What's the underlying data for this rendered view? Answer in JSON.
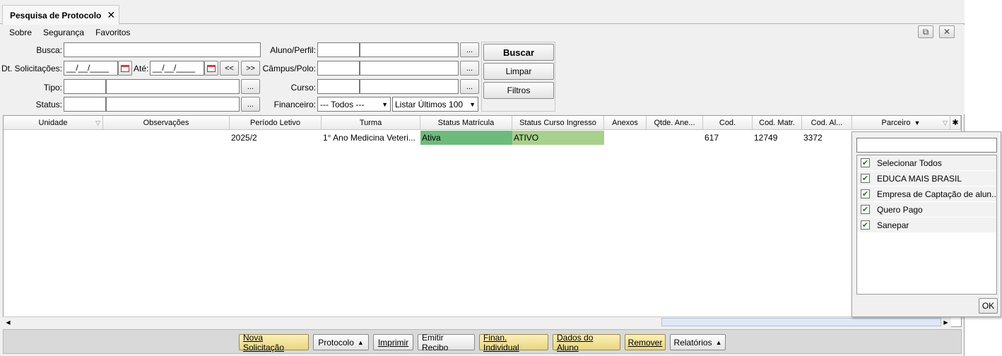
{
  "tab": {
    "title": "Pesquisa de Protocolo",
    "close": "✕"
  },
  "menu": [
    "Sobre",
    "Segurança",
    "Favoritos"
  ],
  "window_buttons": {
    "popout": "⧉",
    "close": "✕"
  },
  "filters": {
    "busca_label": "Busca:",
    "busca_value": "",
    "dt_label": "Dt. Solicitações:",
    "dt_from": "__/__/____",
    "ate_label": "Até:",
    "dt_to": "__/__/____",
    "prev": "<<",
    "next": ">>",
    "tipo_label": "Tipo:",
    "status_label": "Status:",
    "aluno_label": "Aluno/Perfil:",
    "campus_label": "Câmpus/Polo:",
    "curso_label": "Curso:",
    "financeiro_label": "Financeiro:",
    "financeiro_value": "--- Todos ---",
    "listar_value": "Listar Últimos 100",
    "ellipsis": "...",
    "buscar": "Buscar",
    "limpar": "Limpar",
    "filtros": "Filtros"
  },
  "grid": {
    "headers": [
      "Unidade",
      "Observações",
      "Período Letivo",
      "Turma",
      "Status Matrícula",
      "Status Curso Ingresso",
      "Anexos",
      "Qtde. Ane...",
      "Cod.",
      "Cod. Matr.",
      "Cod. Al...",
      "Parceiro"
    ],
    "row": {
      "unidade": "",
      "observacoes": "",
      "periodo": "2025/2",
      "turma": "1°  Ano Medicina Veteri...",
      "status_matricula": "Ativa",
      "status_curso": "ATIVO",
      "anexos": "",
      "qtde": "",
      "cod": "617",
      "cod_matr": "12749",
      "cod_al": "3372"
    },
    "colors": {
      "status_matricula": "#6dbb7b",
      "status_curso": "#a8d08d"
    }
  },
  "parceiro_filter": {
    "search_value": "",
    "items": [
      {
        "label": "Selecionar Todos",
        "checked": true
      },
      {
        "label": "EDUCA MAIS BRASIL",
        "checked": true
      },
      {
        "label": "Empresa de Captação de alun...",
        "checked": true
      },
      {
        "label": "Quero Pago",
        "checked": true
      },
      {
        "label": "Sanepar",
        "checked": true
      }
    ],
    "ok": "OK"
  },
  "bottom_buttons": {
    "nova": "Nova Solicitação",
    "protocolo": "Protocolo",
    "imprimir": "Imprimir",
    "emitir": "Emitir Recibo",
    "finan": "Finan. Individual",
    "dados": "Dados do Aluno",
    "remover": "Remover",
    "relatorios": "Relatórios"
  }
}
